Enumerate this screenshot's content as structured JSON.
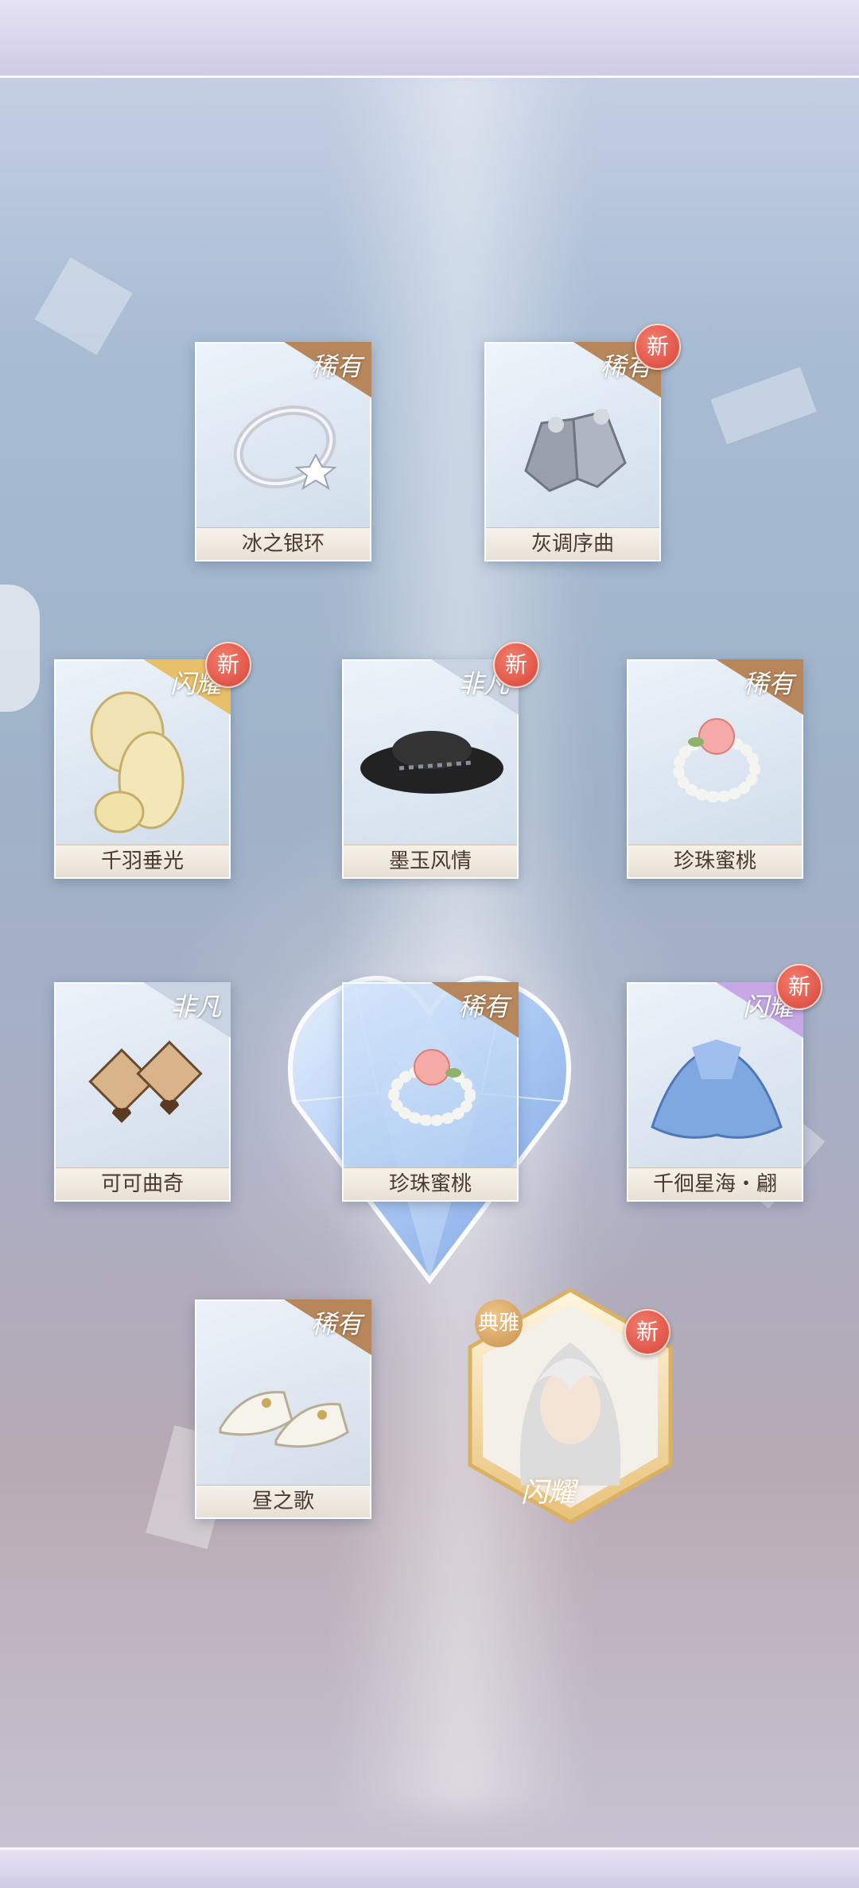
{
  "rarity_labels": {
    "rare": "稀有",
    "extraordinary": "非凡",
    "dazzling": "闪耀",
    "elegant": "典雅"
  },
  "new_label": "新",
  "colors": {
    "rare_ribbon": "#b7865a",
    "extraordinary_ribbon": "#c9d3e2",
    "dazzling_ribbon": "#e9c06a",
    "dazzling_purple_ribbon": "#c7a7e6",
    "new_badge": "#d74538"
  },
  "cards": [
    {
      "name": "冰之银环",
      "rarity": "稀有",
      "is_new": false,
      "icon": "silver-ring-icon"
    },
    {
      "name": "灰调序曲",
      "rarity": "稀有",
      "is_new": true,
      "icon": "gray-gloves-icon"
    },
    {
      "name": "千羽垂光",
      "rarity": "闪耀",
      "is_new": true,
      "icon": "feather-hairpiece-icon"
    },
    {
      "name": "墨玉风情",
      "rarity": "非凡",
      "is_new": true,
      "icon": "black-hat-icon"
    },
    {
      "name": "珍珠蜜桃",
      "rarity": "稀有",
      "is_new": false,
      "icon": "pearl-bracelet-icon"
    },
    {
      "name": "可可曲奇",
      "rarity": "非凡",
      "is_new": false,
      "icon": "cookie-earrings-icon"
    },
    {
      "name": "珍珠蜜桃",
      "rarity": "稀有",
      "is_new": false,
      "icon": "pearl-bracelet-icon"
    },
    {
      "name": "千徊星海・翩",
      "rarity": "闪耀",
      "is_new": true,
      "icon": "blue-dress-icon"
    },
    {
      "name": "昼之歌",
      "rarity": "稀有",
      "is_new": false,
      "icon": "white-shoes-icon"
    }
  ],
  "character_card": {
    "rarity": "典雅",
    "tier": "闪耀",
    "is_new": true,
    "icon": "character-portrait-icon"
  },
  "highlight": {
    "icon": "crystal-heart-icon"
  }
}
